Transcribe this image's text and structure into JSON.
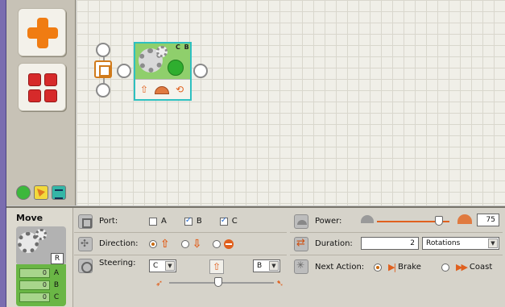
{
  "palette": {
    "buttons": [
      {
        "icon": "common-palette-plus-icon"
      },
      {
        "icon": "complete-palette-grid-icon"
      }
    ],
    "tabs": [
      {
        "icon": "common-tab-icon",
        "color": "#3cb83c"
      },
      {
        "icon": "complete-tab-icon",
        "color": "#f3d93c"
      },
      {
        "icon": "custom-tab-icon",
        "color": "#34b6a6"
      }
    ]
  },
  "canvas": {
    "move_block": {
      "ports_label": "C B",
      "icons": [
        "up-arrow-icon",
        "speedometer-icon",
        "rotation-icon"
      ]
    }
  },
  "config": {
    "block_name": "Move",
    "block_icon_letter": "R",
    "port_feedback": [
      {
        "value": "0",
        "port": "A"
      },
      {
        "value": "0",
        "port": "B"
      },
      {
        "value": "0",
        "port": "C"
      }
    ],
    "port": {
      "label": "Port:",
      "options": [
        {
          "name": "A",
          "checked": false
        },
        {
          "name": "B",
          "checked": true
        },
        {
          "name": "C",
          "checked": true
        }
      ]
    },
    "direction": {
      "label": "Direction:",
      "selected": "forward"
    },
    "steering": {
      "label": "Steering:",
      "left_port": "C",
      "right_port": "B",
      "level": 0.5
    },
    "power": {
      "label": "Power:",
      "value": "75",
      "level": 0.75
    },
    "duration": {
      "label": "Duration:",
      "value": "2",
      "unit": "Rotations"
    },
    "next_action": {
      "label": "Next Action:",
      "options": [
        {
          "name": "Brake",
          "selected": true
        },
        {
          "name": "Coast",
          "selected": false
        }
      ]
    }
  },
  "colors": {
    "accent_orange": "#e0601e",
    "block_green": "#6ab645",
    "selection_cyan": "#2ec0c0"
  }
}
